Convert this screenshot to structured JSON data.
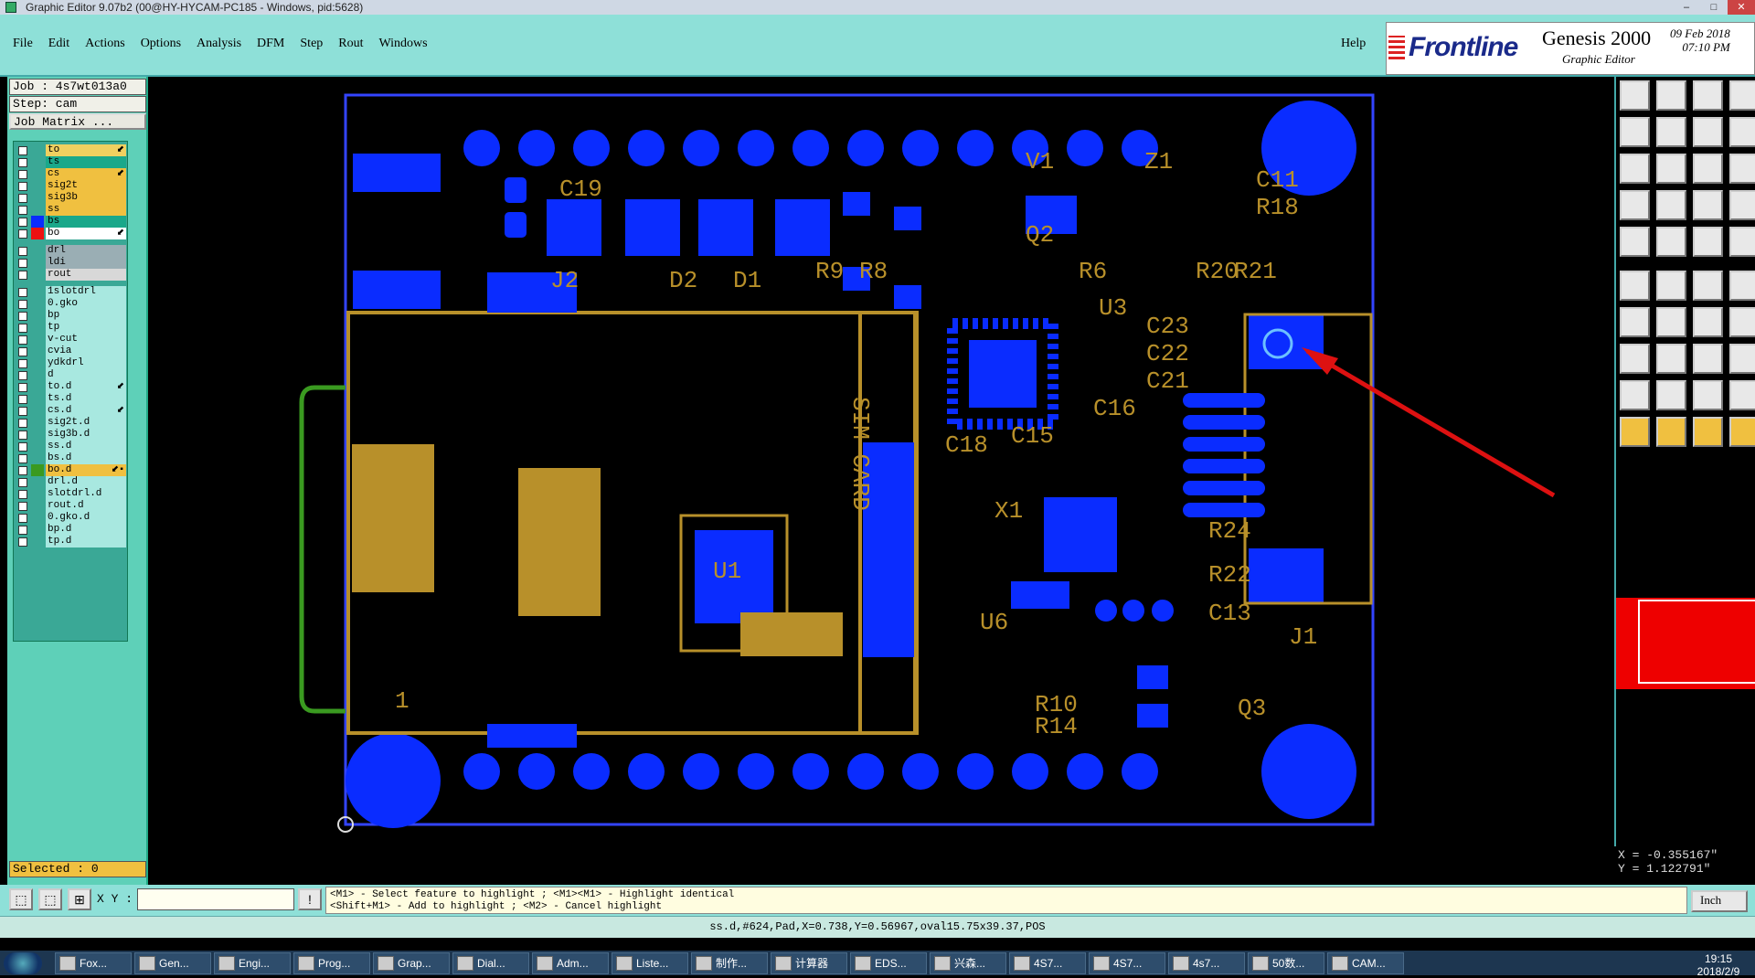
{
  "window": {
    "title": "Graphic Editor 9.07b2 (00@HY-HYCAM-PC185 - Windows, pid:5628)"
  },
  "menu": {
    "items": [
      "File",
      "Edit",
      "Actions",
      "Options",
      "Analysis",
      "DFM",
      "Step",
      "Rout",
      "Windows"
    ],
    "help": "Help"
  },
  "branding": {
    "logo": "Frontline",
    "product": "Genesis 2000",
    "subtitle": "Graphic Editor",
    "date": "09 Feb 2018",
    "time": "07:10 PM"
  },
  "job": {
    "job_label": "Job : 4s7wt013a0",
    "step_label": "Step: cam",
    "matrix_button": "Job Matrix ..."
  },
  "layers": [
    {
      "name": "to",
      "color": "#f0d060",
      "mark": "⬋"
    },
    {
      "name": "ts",
      "color": "#1aa88a",
      "mark": ""
    },
    {
      "name": "cs",
      "color": "#f0c040",
      "mark": "⬋"
    },
    {
      "name": "sig2t",
      "color": "#f0c040",
      "mark": ""
    },
    {
      "name": "sig3b",
      "color": "#f0c040",
      "mark": ""
    },
    {
      "name": "ss",
      "color": "#f0c040",
      "mark": ""
    },
    {
      "name": "bs",
      "color": "#1aa88a",
      "mark": ""
    },
    {
      "name": "bo",
      "color": "#ffffff",
      "mark": "⬋"
    },
    {
      "name": "drl",
      "color": "#9aaeb4",
      "mark": ""
    },
    {
      "name": "ldi",
      "color": "#9aaeb4",
      "mark": ""
    },
    {
      "name": "rout",
      "color": "#d8d8d8",
      "mark": ""
    },
    {
      "name": "1slotdrl",
      "color": "#a8e8e0",
      "mark": ""
    },
    {
      "name": "0.gko",
      "color": "#a8e8e0",
      "mark": ""
    },
    {
      "name": "bp",
      "color": "#a8e8e0",
      "mark": ""
    },
    {
      "name": "tp",
      "color": "#a8e8e0",
      "mark": ""
    },
    {
      "name": "v-cut",
      "color": "#a8e8e0",
      "mark": ""
    },
    {
      "name": "cvia",
      "color": "#a8e8e0",
      "mark": ""
    },
    {
      "name": "ydkdrl",
      "color": "#a8e8e0",
      "mark": ""
    },
    {
      "name": "d",
      "color": "#a8e8e0",
      "mark": ""
    },
    {
      "name": "to.d",
      "color": "#a8e8e0",
      "mark": "⬋"
    },
    {
      "name": "ts.d",
      "color": "#a8e8e0",
      "mark": ""
    },
    {
      "name": "cs.d",
      "color": "#a8e8e0",
      "mark": "⬋"
    },
    {
      "name": "sig2t.d",
      "color": "#a8e8e0",
      "mark": ""
    },
    {
      "name": "sig3b.d",
      "color": "#a8e8e0",
      "mark": ""
    },
    {
      "name": "ss.d",
      "color": "#a8e8e0",
      "mark": ""
    },
    {
      "name": "bs.d",
      "color": "#a8e8e0",
      "mark": ""
    },
    {
      "name": "bo.d",
      "color": "#f0c040",
      "mark": "⬋▪"
    },
    {
      "name": "drl.d",
      "color": "#a8e8e0",
      "mark": ""
    },
    {
      "name": "slotdrl.d",
      "color": "#a8e8e0",
      "mark": ""
    },
    {
      "name": "rout.d",
      "color": "#a8e8e0",
      "mark": ""
    },
    {
      "name": "0.gko.d",
      "color": "#a8e8e0",
      "mark": ""
    },
    {
      "name": "bp.d",
      "color": "#a8e8e0",
      "mark": ""
    },
    {
      "name": "tp.d",
      "color": "#a8e8e0",
      "mark": ""
    }
  ],
  "selected": "Selected : 0",
  "board_labels": [
    "V1",
    "Z1",
    "C11",
    "R18",
    "C19",
    "Q2",
    "J2",
    "D2",
    "D1",
    "R9",
    "R8",
    "R6",
    "R20",
    "R21",
    "U3",
    "C23",
    "C22",
    "C21",
    "C16",
    "C15",
    "C18",
    "SIM CARD",
    "X1",
    "U1",
    "U6",
    "R24",
    "R22",
    "C13",
    "J1",
    "R10",
    "R14",
    "Q3",
    "1"
  ],
  "coords": {
    "x": "X = -0.355167\"",
    "y": "Y = 1.122791\""
  },
  "xy_label": "X Y :",
  "hint": {
    "line1": "<M1> - Select feature to highlight ; <M1><M1> - Highlight identical",
    "line2": "<Shift+M1> - Add to highlight ; <M2> - Cancel highlight"
  },
  "unit": "Inch",
  "status": "ss.d,#624,Pad,X=0.738,Y=0.56967,oval15.75x39.37,POS",
  "taskbar": {
    "tasks": [
      "Fox...",
      "Gen...",
      "Engi...",
      "Prog...",
      "Grap...",
      "Dial...",
      "Adm...",
      "Liste...",
      "制作...",
      "计算器",
      "EDS...",
      "兴森...",
      "4S7...",
      "4S7...",
      "4s7...",
      "50数...",
      "CAM..."
    ],
    "time": "19:15",
    "date": "2018/2/9"
  },
  "colors": {
    "pad": "#0a2cff",
    "silk": "#b8902a",
    "outline": "#3344ff",
    "menu_bg": "#8ee0d8",
    "panel_bg": "#5ed0b8",
    "arrow": "#dd1111"
  }
}
